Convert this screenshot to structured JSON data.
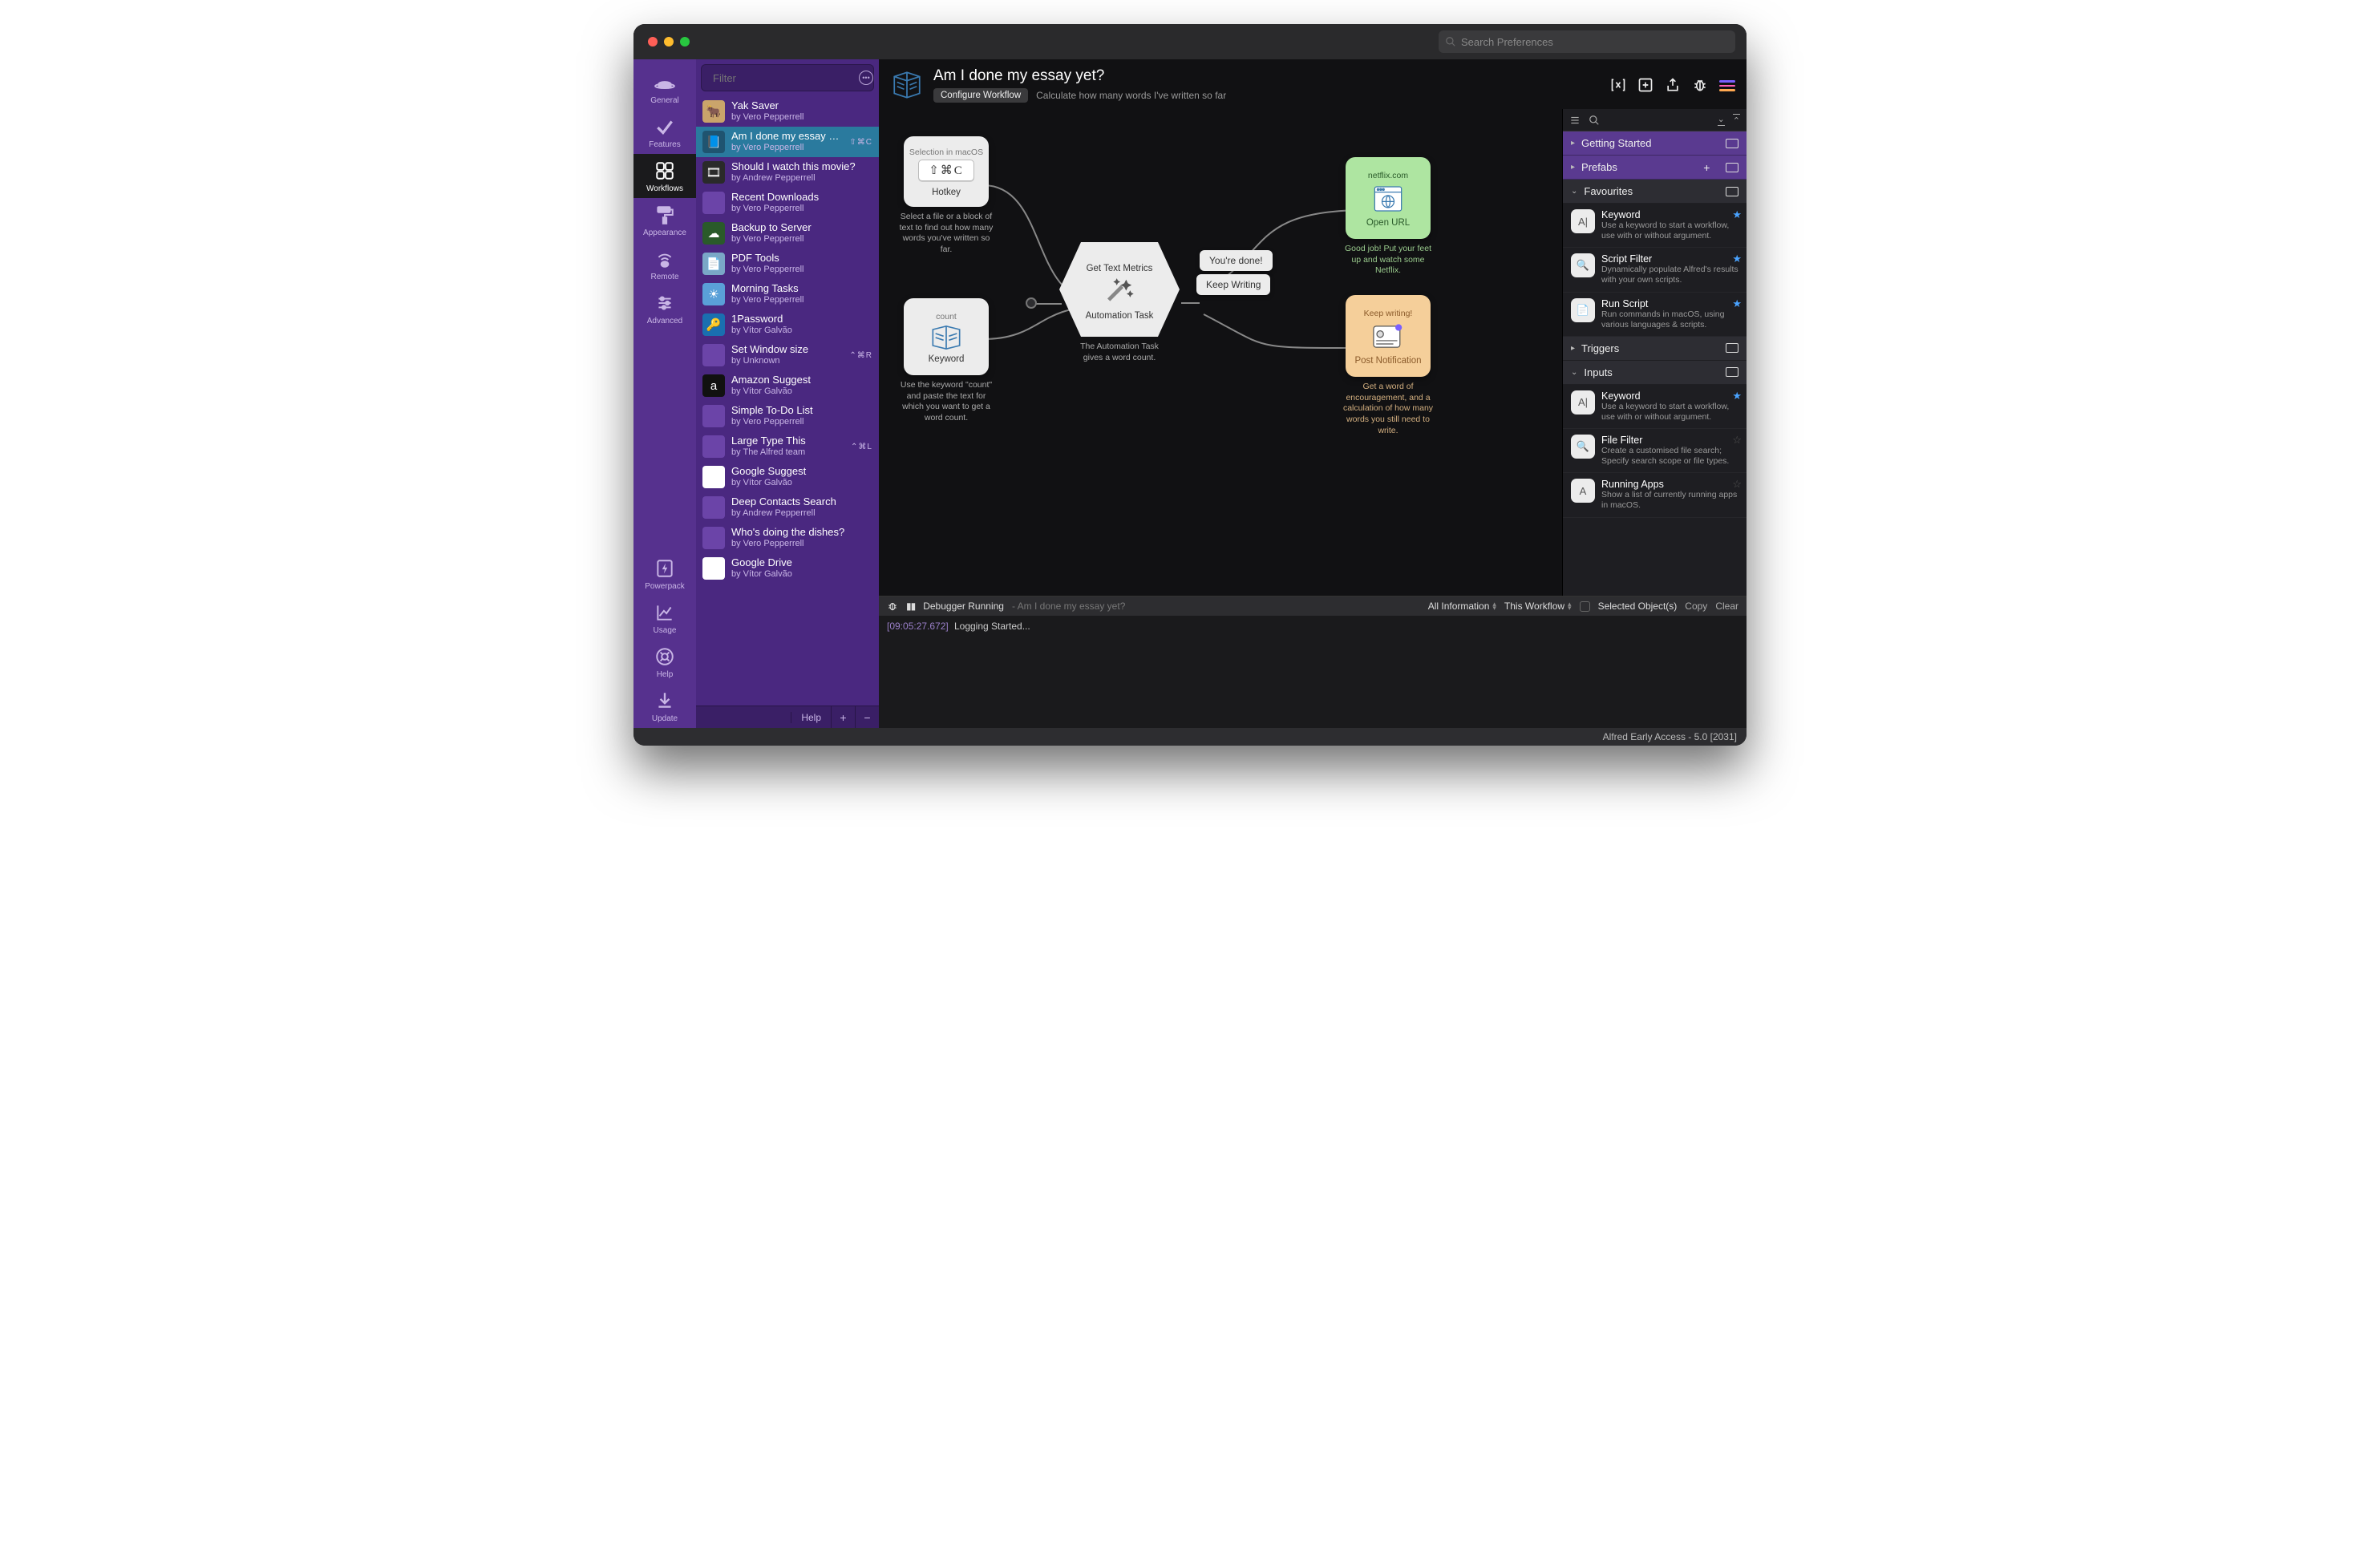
{
  "search_pref_placeholder": "Search Preferences",
  "nav": [
    {
      "label": "General",
      "icon": "hat"
    },
    {
      "label": "Features",
      "icon": "check"
    },
    {
      "label": "Workflows",
      "icon": "grid",
      "selected": true
    },
    {
      "label": "Appearance",
      "icon": "roller"
    },
    {
      "label": "Remote",
      "icon": "remote"
    },
    {
      "label": "Advanced",
      "icon": "sliders"
    }
  ],
  "nav_bottom": [
    {
      "label": "Powerpack",
      "icon": "bolt"
    },
    {
      "label": "Usage",
      "icon": "chart"
    },
    {
      "label": "Help",
      "icon": "help"
    },
    {
      "label": "Update",
      "icon": "download"
    }
  ],
  "filter_placeholder": "Filter",
  "workflows": [
    {
      "title": "Yak Saver",
      "author": "by Vero Pepperrell",
      "bg": "#caa46b"
    },
    {
      "title": "Am I done my essay yet?",
      "author": "by Vero Pepperrell",
      "shortcut": "⇧⌘C",
      "selected": true,
      "bg": "#1f5470"
    },
    {
      "title": "Should I watch this movie?",
      "author": "by Andrew Pepperrell",
      "bg": "#2a2a2a"
    },
    {
      "title": "Recent Downloads",
      "author": "by Vero Pepperrell",
      "bg": "#6b44a8"
    },
    {
      "title": "Backup to Server",
      "author": "by Vero Pepperrell",
      "bg": "#2a5a2a"
    },
    {
      "title": "PDF Tools",
      "author": "by Vero Pepperrell",
      "bg": "#7aa7c7"
    },
    {
      "title": "Morning Tasks",
      "author": "by Vero Pepperrell",
      "bg": "#5aa0d8"
    },
    {
      "title": "1Password",
      "author": "by Vítor Galvão",
      "bg": "#1a6fb0"
    },
    {
      "title": "Set Window size",
      "author": "by Unknown",
      "shortcut": "⌃⌘R",
      "bg": "#6b44a8"
    },
    {
      "title": "Amazon Suggest",
      "author": "by Vítor Galvão",
      "bg": "#111"
    },
    {
      "title": "Simple To-Do List",
      "author": "by Vero Pepperrell",
      "bg": "#6b44a8"
    },
    {
      "title": "Large Type This",
      "author": "by The Alfred team",
      "shortcut": "⌃⌘L",
      "bg": "#6b44a8"
    },
    {
      "title": "Google Suggest",
      "author": "by Vítor Galvão",
      "bg": "#fff"
    },
    {
      "title": "Deep Contacts Search",
      "author": "by Andrew Pepperrell",
      "bg": "#6b44a8"
    },
    {
      "title": "Who's doing the dishes?",
      "author": "by Vero Pepperrell",
      "bg": "#6b44a8"
    },
    {
      "title": "Google Drive",
      "author": "by Vítor Galvão",
      "bg": "#fff"
    }
  ],
  "list_footer": {
    "help": "Help"
  },
  "header": {
    "title": "Am I done my essay yet?",
    "configure": "Configure Workflow",
    "desc": "Calculate how many words I've written so far"
  },
  "nodes": {
    "hotkey": {
      "top": "Selection in macOS",
      "key": "⇧⌘C",
      "label": "Hotkey",
      "desc": "Select a file or a block of text to find out how many words you've written so far."
    },
    "keyword": {
      "top": "count",
      "label": "Keyword",
      "desc": "Use the keyword \"count\" and paste the text for which you want to get a word count."
    },
    "auto": {
      "top": "Get Text Metrics",
      "label": "Automation Task",
      "desc": "The Automation Task gives a word count."
    },
    "chip_done": "You're done!",
    "chip_keep": "Keep Writing",
    "openurl": {
      "top": "netflix.com",
      "label": "Open URL",
      "desc": "Good job! Put your feet up and watch some Netflix."
    },
    "notify": {
      "top": "Keep writing!",
      "label": "Post Notification",
      "desc": "Get a word of encouragement, and a calculation of how many words you still need to write."
    }
  },
  "palette": {
    "sections": {
      "getting": "Getting Started",
      "prefabs": "Prefabs",
      "favourites": "Favourites",
      "triggers": "Triggers",
      "inputs": "Inputs"
    },
    "fav_items": [
      {
        "title": "Keyword",
        "desc": "Use a keyword to start a workflow, use with or without argument.",
        "star": true,
        "glyph": "A|"
      },
      {
        "title": "Script Filter",
        "desc": "Dynamically populate Alfred's results with your own scripts.",
        "star": true,
        "glyph": "🔍"
      },
      {
        "title": "Run Script",
        "desc": "Run commands in macOS, using various languages & scripts.",
        "star": true,
        "glyph": "📄"
      }
    ],
    "input_items": [
      {
        "title": "Keyword",
        "desc": "Use a keyword to start a workflow, use with or without argument.",
        "star": true,
        "glyph": "A|"
      },
      {
        "title": "File Filter",
        "desc": "Create a customised file search; Specify search scope or file types.",
        "glyph": "🔍"
      },
      {
        "title": "Running Apps",
        "desc": "Show a list of currently running apps in macOS.",
        "glyph": "A"
      }
    ]
  },
  "debugger": {
    "status": "Debugger Running",
    "context": "Am I done my essay yet?",
    "filter1": "All Information",
    "filter2": "This Workflow",
    "selected": "Selected Object(s)",
    "copy": "Copy",
    "clear": "Clear",
    "log_ts": "[09:05:27.672]",
    "log_msg": "Logging Started..."
  },
  "status_bar": "Alfred Early Access - 5.0 [2031]"
}
